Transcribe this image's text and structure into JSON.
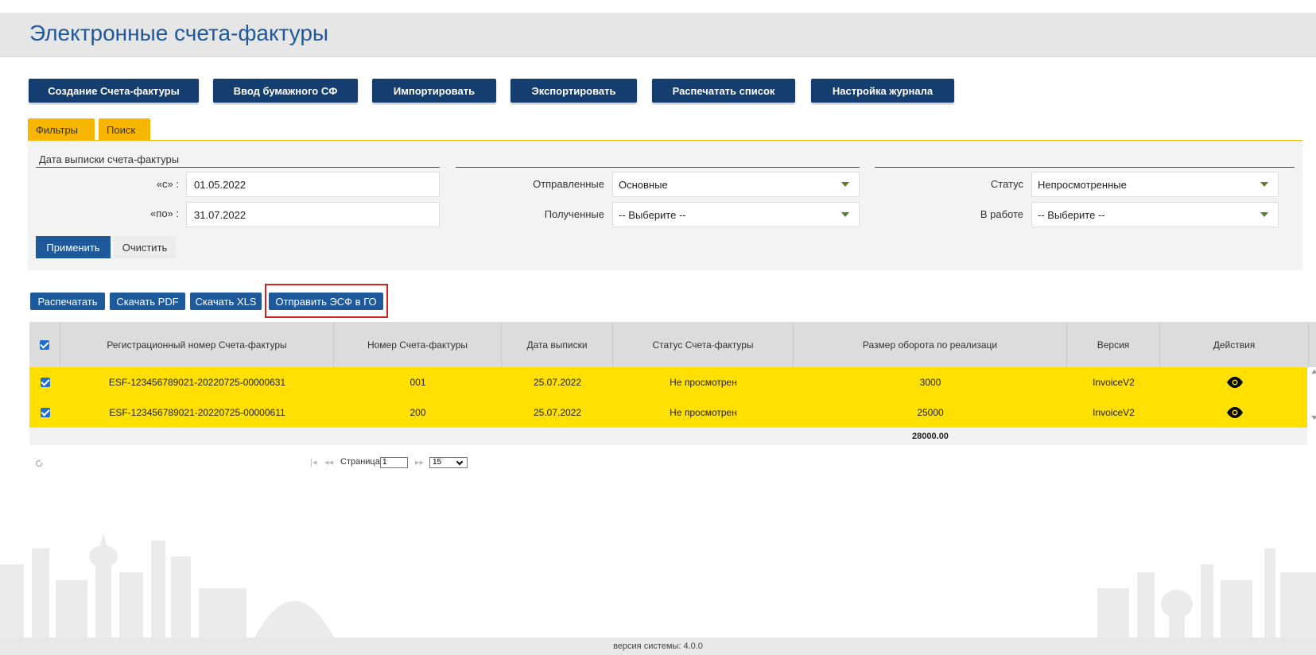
{
  "header": {
    "title": "Электронные счета-фактуры"
  },
  "toolbar": {
    "buttons": [
      "Создание Счета-фактуры",
      "Ввод бумажного СФ",
      "Импортировать",
      "Экспортировать",
      "Распечатать список",
      "Настройка журнала"
    ]
  },
  "tabs": [
    "Фильтры",
    "Поиск"
  ],
  "filters": {
    "date_group_title": "Дата выписки счета-фактуры",
    "from_label": "«с» :",
    "from_value": "01.05.2022",
    "to_label": "«по» :",
    "to_value": "31.07.2022",
    "sent_label": "Отправленные",
    "sent_value": "Основные",
    "received_label": "Полученные",
    "received_value": "-- Выберите --",
    "status_label": "Статус",
    "status_value": "Непросмотренные",
    "inwork_label": "В работе",
    "inwork_value": "-- Выберите --",
    "apply_label": "Применить",
    "clear_label": "Очистить"
  },
  "actions": {
    "print": "Распечатать",
    "pdf": "Скачать PDF",
    "xls": "Скачать XLS",
    "send": "Отправить ЭСФ в ГО"
  },
  "grid": {
    "columns": [
      "Регистрационный номер Счета-фактуры",
      "Номер Счета-фактуры",
      "Дата выписки",
      "Статус Счета-фактуры",
      "Размер оборота по реализаци",
      "Версия",
      "Действия"
    ],
    "rows": [
      {
        "reg": "ESF-123456789021-20220725-00000631",
        "num": "001",
        "date": "25.07.2022",
        "status": "Не просмотрен",
        "amount": "3000",
        "version": "InvoiceV2"
      },
      {
        "reg": "ESF-123456789021-20220725-00000611",
        "num": "200",
        "date": "25.07.2022",
        "status": "Не просмотрен",
        "amount": "25000",
        "version": "InvoiceV2"
      }
    ],
    "total": "28000.00"
  },
  "pager": {
    "page_label": "Страница",
    "page": "1",
    "page_size": "15"
  },
  "footer": {
    "version": "версия системы: 4.0.0"
  },
  "colors": {
    "brand": "#153e70",
    "accent": "#f7b500",
    "row_highlight": "#ffe000",
    "title": "#1e5a9b"
  }
}
